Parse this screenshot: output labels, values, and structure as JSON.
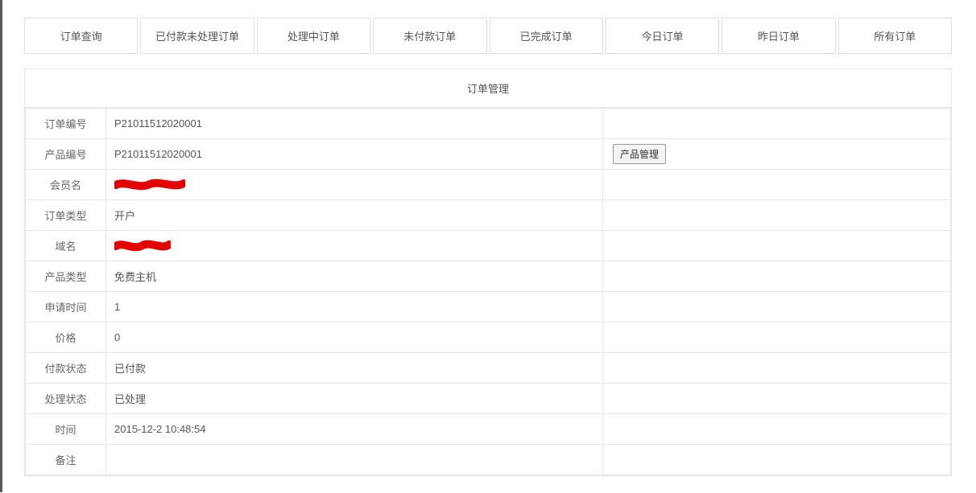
{
  "tabs": [
    "订单查询",
    "已付款未处理订单",
    "处理中订单",
    "未付款订单",
    "已完成订单",
    "今日订单",
    "昨日订单",
    "所有订单"
  ],
  "panel": {
    "title": "订单管理"
  },
  "detail": {
    "rows": [
      {
        "label": "订单编号",
        "value": "P21011512020001",
        "action": ""
      },
      {
        "label": "产品编号",
        "value": "P21011512020001",
        "action": "产品管理"
      },
      {
        "label": "会员名",
        "value": "",
        "action": "",
        "redacted": true,
        "redactWidth": 88
      },
      {
        "label": "订单类型",
        "value": "开户",
        "action": ""
      },
      {
        "label": "域名",
        "value": "",
        "action": "",
        "redacted": true,
        "redactWidth": 70
      },
      {
        "label": "产品类型",
        "value": "免费主机",
        "action": ""
      },
      {
        "label": "申请时间",
        "value": "1",
        "action": ""
      },
      {
        "label": "价格",
        "value": "0",
        "action": ""
      },
      {
        "label": "付款状态",
        "value": "已付款",
        "action": ""
      },
      {
        "label": "处理状态",
        "value": "已处理",
        "action": ""
      },
      {
        "label": "时间",
        "value": "2015-12-2 10:48:54",
        "action": ""
      },
      {
        "label": "备注",
        "value": "",
        "action": ""
      }
    ]
  }
}
